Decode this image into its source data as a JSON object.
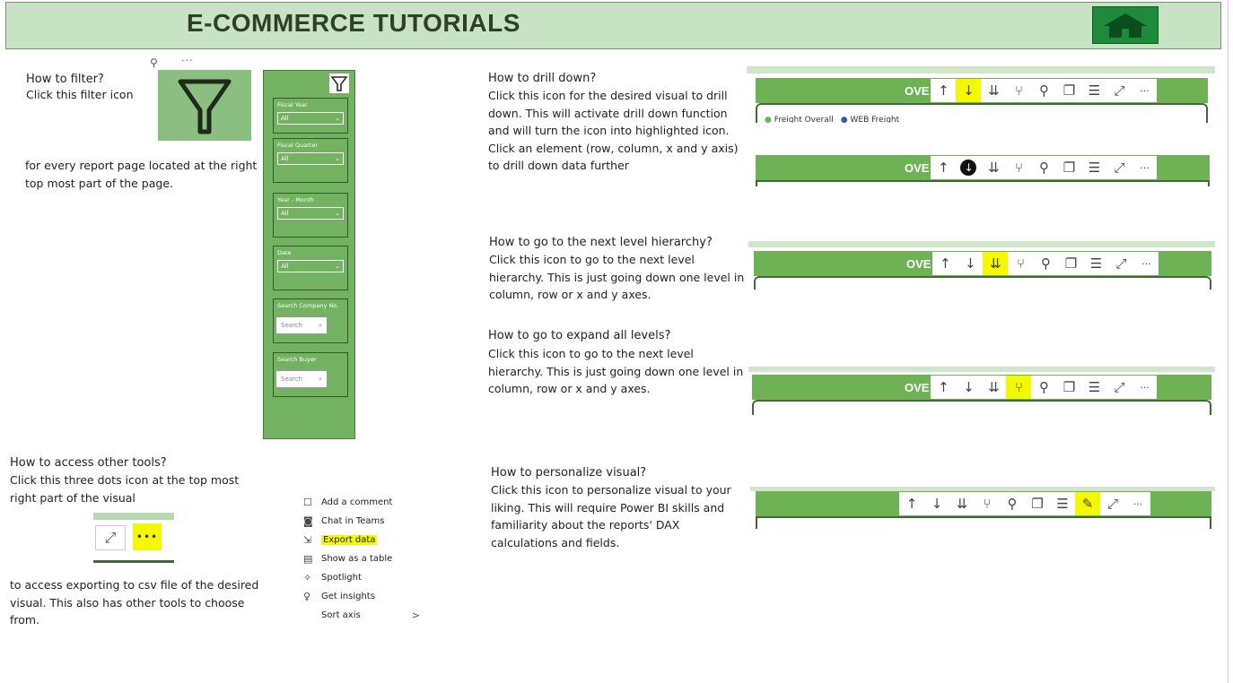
{
  "header": {
    "title": "E-COMMERCE TUTORIALS",
    "home_icon": "home-icon",
    "bg": "#c8e2c4",
    "home_bg": "#1d8a3c"
  },
  "filter_section": {
    "heading": "How to filter?",
    "line2": "Click this filter icon",
    "desc": " for every report page located at the right\ntop most part of the page.",
    "tile_icons": [
      "pin-icon",
      "more-icon",
      "funnel-icon"
    ]
  },
  "filter_pane": {
    "cards": [
      {
        "label": "Fiscal Year",
        "value": "All"
      },
      {
        "label": "Fiscal Quarter",
        "value": "All"
      },
      {
        "label": "Year - Month",
        "value": "All"
      },
      {
        "label": "Date",
        "value": "All"
      }
    ],
    "search_cards": [
      {
        "label": "Search Company No.",
        "placeholder": "Search"
      },
      {
        "label": "Search Buyer",
        "placeholder": "Search"
      }
    ]
  },
  "drill_down": {
    "heading": "How to drill down?",
    "desc": "Click this icon for the desired visual to drill\ndown. This will activate drill down function\nand will turn the icon into highlighted icon.\nClick an element (row, column, x and y axis)\nto drill down data further"
  },
  "next_level": {
    "heading": "How to go to the next level hierarchy?",
    "desc": "Click this icon to go to the next level\nhierarchy. This is just going down one level in\ncolumn, row or x and y axes."
  },
  "expand_all": {
    "heading": "How to go to expand all levels?",
    "desc": "Click this icon to go to the next level\nhierarchy. This is just going down one level in\ncolumn, row or x and y axes."
  },
  "personalize": {
    "heading": "How to personalize visual?",
    "desc": "Click this icon to personalize visual to your\nliking. This will require Power BI skills and\nfamiliarity about the reports' DAX\ncalculations and fields."
  },
  "other_tools": {
    "heading": "How to access other tools?",
    "desc1": "Click this three dots icon at the top most\nright part of the visual",
    "desc2": " to access exporting to csv file of the desired\nvisual. This also has other tools to choose\nfrom."
  },
  "toolbar": {
    "ov_text": "OVE",
    "legend1": "Freight Overall",
    "legend2": "WEB Freight",
    "highlight_color": "#f4f800"
  },
  "context_menu": {
    "items": [
      {
        "icon": "comment-icon",
        "label": "Add a comment",
        "highlight": false
      },
      {
        "icon": "teams-icon",
        "label": "Chat in Teams",
        "highlight": false
      },
      {
        "icon": "export-icon",
        "label": "Export data",
        "highlight": true
      },
      {
        "icon": "table-icon",
        "label": "Show as a table",
        "highlight": false
      },
      {
        "icon": "spotlight-icon",
        "label": "Spotlight",
        "highlight": false
      },
      {
        "icon": "insights-icon",
        "label": "Get insights",
        "highlight": false
      },
      {
        "icon": "",
        "label": "Sort axis",
        "highlight": false
      }
    ]
  }
}
